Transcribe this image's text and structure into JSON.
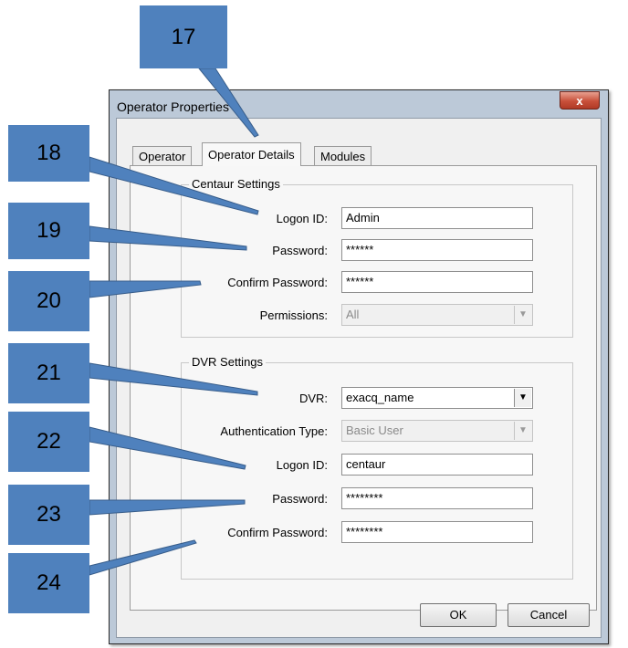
{
  "dialog": {
    "title": "Operator Properties",
    "close_glyph": "x",
    "tabs": [
      {
        "label": "Operator"
      },
      {
        "label": "Operator Details"
      },
      {
        "label": "Modules"
      }
    ],
    "centaur": {
      "legend": "Centaur Settings",
      "logon_id_label": "Logon ID:",
      "logon_id_value": "Admin",
      "password_label": "Password:",
      "password_value": "******",
      "confirm_label": "Confirm Password:",
      "confirm_value": "******",
      "permissions_label": "Permissions:",
      "permissions_value": "All"
    },
    "dvr": {
      "legend": "DVR Settings",
      "dvr_label": "DVR:",
      "dvr_value": "exacq_name",
      "auth_label": "Authentication Type:",
      "auth_value": "Basic User",
      "logon_id_label": "Logon ID:",
      "logon_id_value": "centaur",
      "password_label": "Password:",
      "password_value": "********",
      "confirm_label": "Confirm Password:",
      "confirm_value": "********"
    },
    "ok_label": "OK",
    "cancel_label": "Cancel"
  },
  "callouts": [
    "17",
    "18",
    "19",
    "20",
    "21",
    "22",
    "23",
    "24"
  ],
  "colors": {
    "callout_fill": "#4f81bd",
    "callout_outline": "#385d8a",
    "dialog_frame": "#bcc9d8",
    "close_button": "#c8503a"
  }
}
